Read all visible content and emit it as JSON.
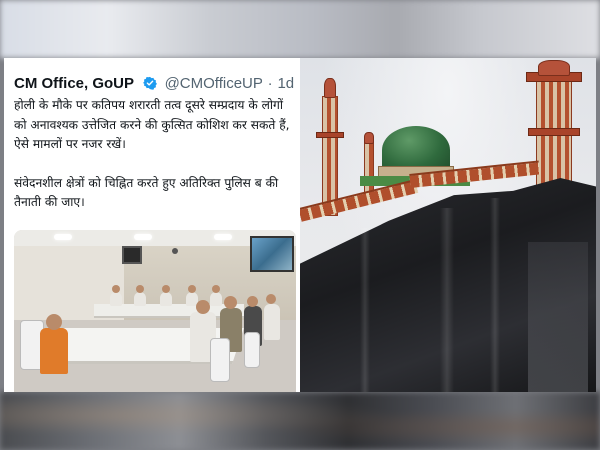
{
  "tweet": {
    "author": "CM Office, GoUP",
    "handle": "@CMOfficeUP",
    "separator": "·",
    "time": "1d",
    "paragraph_1": "होली के मौके पर कतिपय शरारती तत्व दूसरे सम्प्रदाय के लोगों को अनावश्यक उत्तेजित करने की कुत्सित कोशिश कर सकते हैं, ऐसे मामलों पर नजर रखें।",
    "paragraph_2": "संवेदनशील क्षेत्रों को चिह्नित करते हुए अतिरिक्त पुलिस ब की तैनाती की जाए।"
  },
  "colors": {
    "verified": "#1d9bf0",
    "tarp": "#1b1c1f",
    "dome": "#2f6a3d",
    "minaret": "#b4512f"
  },
  "icons": {
    "verified_badge": "verified-icon"
  }
}
